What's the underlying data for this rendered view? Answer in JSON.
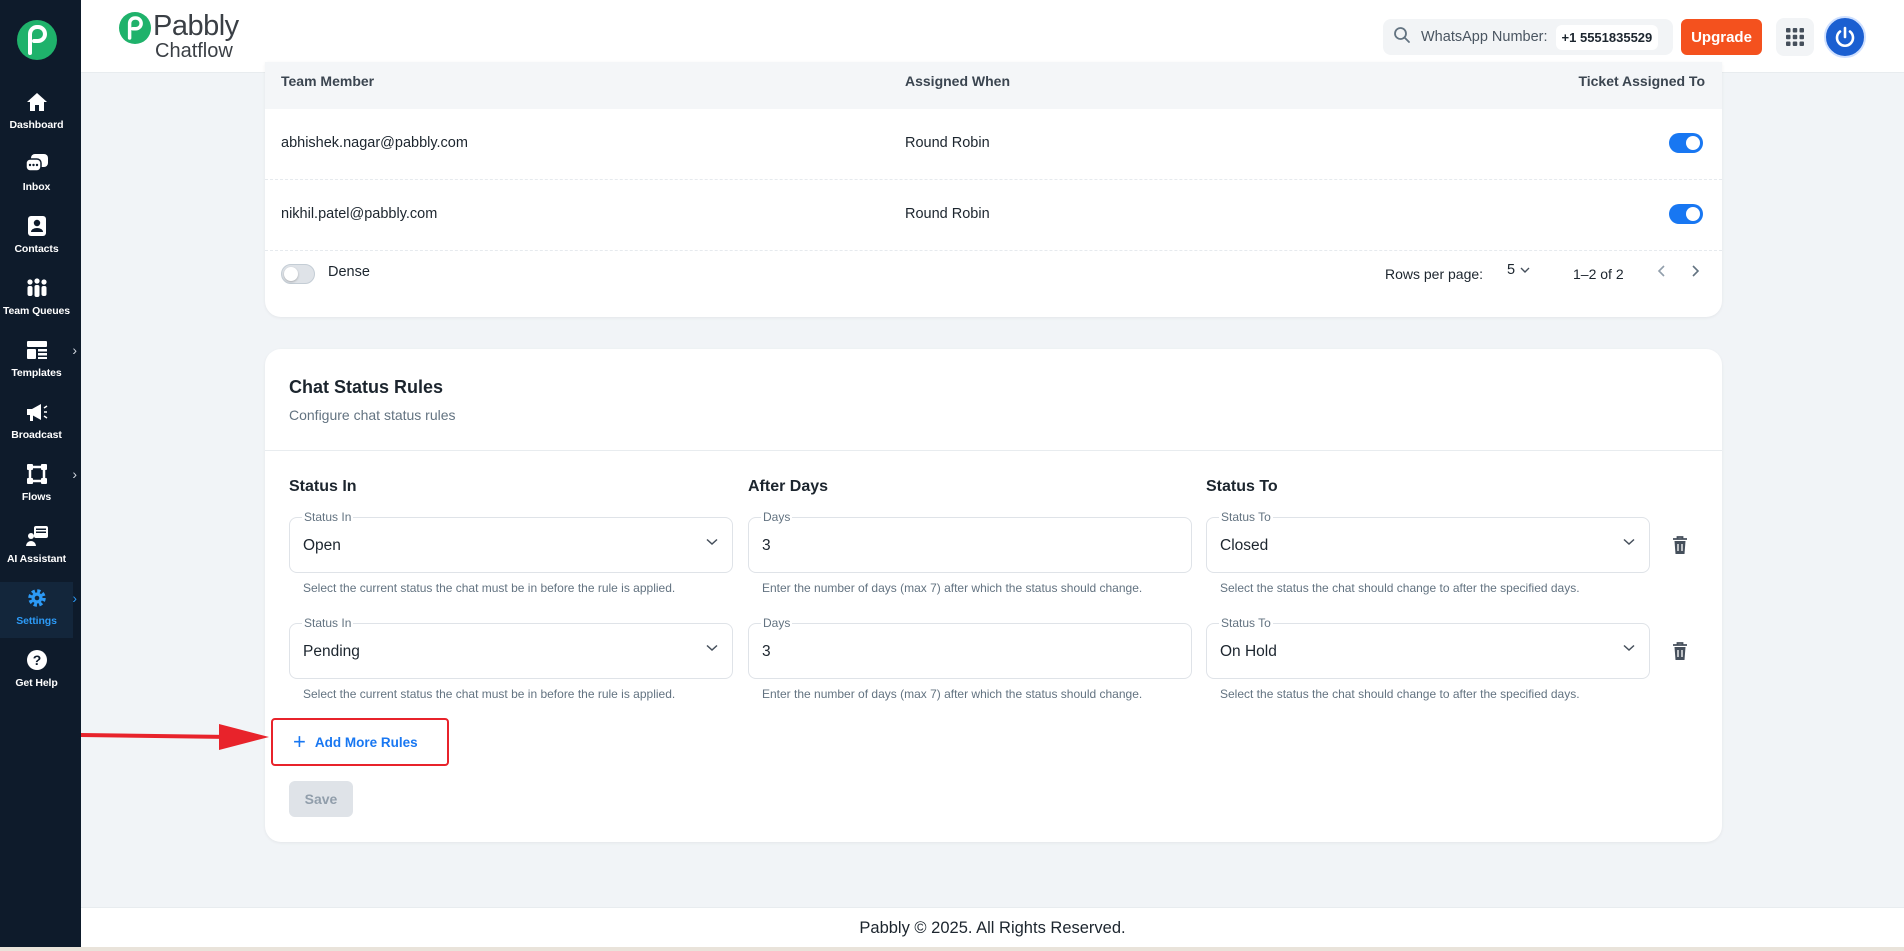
{
  "colors": {
    "sidebar_bg": "#0e1b2b",
    "brand_green": "#1fb26b",
    "primary_blue": "#1877f2",
    "upgrade_orange": "#f4511e",
    "annotation_red": "#e8232b"
  },
  "sidebar": {
    "items": [
      {
        "label": "Dashboard",
        "icon": "home-icon"
      },
      {
        "label": "Inbox",
        "icon": "inbox-chat-icon"
      },
      {
        "label": "Contacts",
        "icon": "contacts-icon"
      },
      {
        "label": "Team Queues",
        "icon": "team-icon"
      },
      {
        "label": "Templates",
        "icon": "templates-icon"
      },
      {
        "label": "Broadcast",
        "icon": "megaphone-icon"
      },
      {
        "label": "Flows",
        "icon": "flows-icon"
      },
      {
        "label": "AI Assistant",
        "icon": "ai-assistant-icon"
      },
      {
        "label": "Settings",
        "icon": "gear-icon",
        "active": true
      },
      {
        "label": "Get Help",
        "icon": "help-icon"
      }
    ]
  },
  "header": {
    "brand_name": "Pabbly",
    "brand_sub": "Chatflow",
    "whatsapp_label": "WhatsApp Number:",
    "whatsapp_number": "+1 5551835529",
    "upgrade_label": "Upgrade"
  },
  "team_table": {
    "columns": [
      "Team Member",
      "Assigned When",
      "Ticket Assigned To"
    ],
    "rows": [
      {
        "member": "abhishek.nagar@pabbly.com",
        "assigned_when": "Round Robin",
        "assigned": true
      },
      {
        "member": "nikhil.patel@pabbly.com",
        "assigned_when": "Round Robin",
        "assigned": true
      }
    ],
    "dense_label": "Dense",
    "dense_on": false,
    "rows_per_page_label": "Rows per page:",
    "rows_per_page": "5",
    "range": "1–2 of 2"
  },
  "chat_status": {
    "title": "Chat Status Rules",
    "subtitle": "Configure chat status rules",
    "col_status_in": "Status In",
    "col_after_days": "After Days",
    "col_status_to": "Status To",
    "field_label_status_in": "Status In",
    "field_label_days": "Days",
    "field_label_status_to": "Status To",
    "helper_status_in": "Select the current status the chat must be in before the rule is applied.",
    "helper_days": "Enter the number of days (max 7) after which the status should change.",
    "helper_status_to": "Select the status the chat should change to after the specified days.",
    "rules": [
      {
        "status_in": "Open",
        "days": "3",
        "status_to": "Closed"
      },
      {
        "status_in": "Pending",
        "days": "3",
        "status_to": "On Hold"
      }
    ],
    "add_label": "Add More Rules",
    "save_label": "Save"
  },
  "footer": {
    "text": "Pabbly © 2025. All Rights Reserved."
  }
}
